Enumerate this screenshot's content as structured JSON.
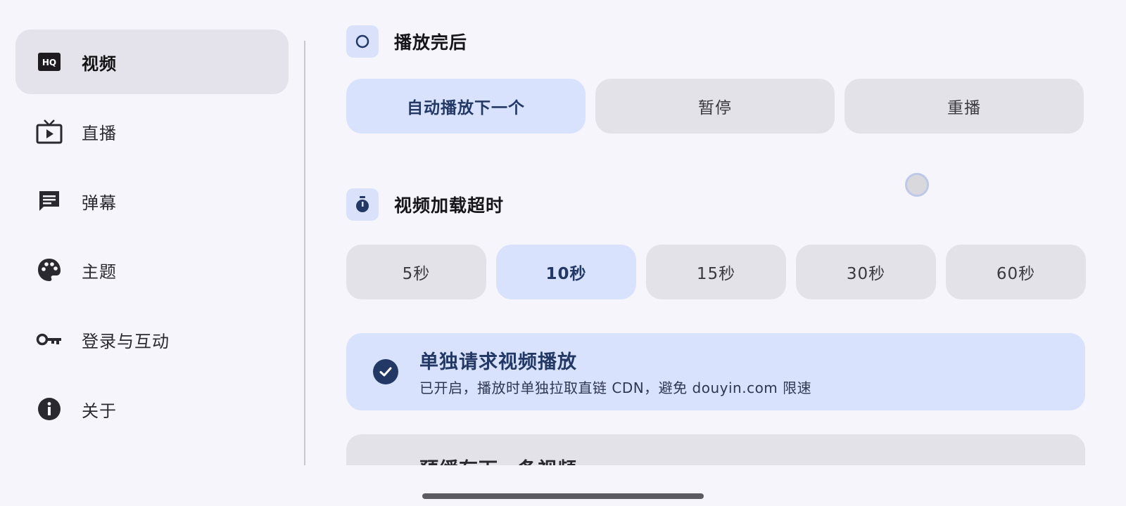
{
  "sidebar": {
    "items": [
      {
        "label": "视频",
        "icon": "hq-icon",
        "active": true
      },
      {
        "label": "直播",
        "icon": "tv-icon",
        "active": false
      },
      {
        "label": "弹幕",
        "icon": "comment-icon",
        "active": false
      },
      {
        "label": "主题",
        "icon": "palette-icon",
        "active": false
      },
      {
        "label": "登录与互动",
        "icon": "key-icon",
        "active": false
      },
      {
        "label": "关于",
        "icon": "info-icon",
        "active": false
      }
    ]
  },
  "main": {
    "play_end": {
      "title": "播放完后",
      "options": [
        "自动播放下一个",
        "暂停",
        "重播"
      ],
      "selected": "自动播放下一个"
    },
    "load_timeout": {
      "title": "视频加载超时",
      "options": [
        "5秒",
        "10秒",
        "15秒",
        "30秒",
        "60秒"
      ],
      "selected": "10秒"
    },
    "separate_request": {
      "title": "单独请求视频播放",
      "subtitle": "已开启，播放时单独拉取直链 CDN，避免 douyin.com 限速",
      "enabled": true
    },
    "precache": {
      "title": "预缓存下一条视频",
      "enabled": false
    }
  },
  "colors": {
    "accent": "#233865",
    "selected_bg": "#d8e2fd",
    "unselected_bg": "#e3e2e9",
    "background": "#f6f5fb"
  }
}
